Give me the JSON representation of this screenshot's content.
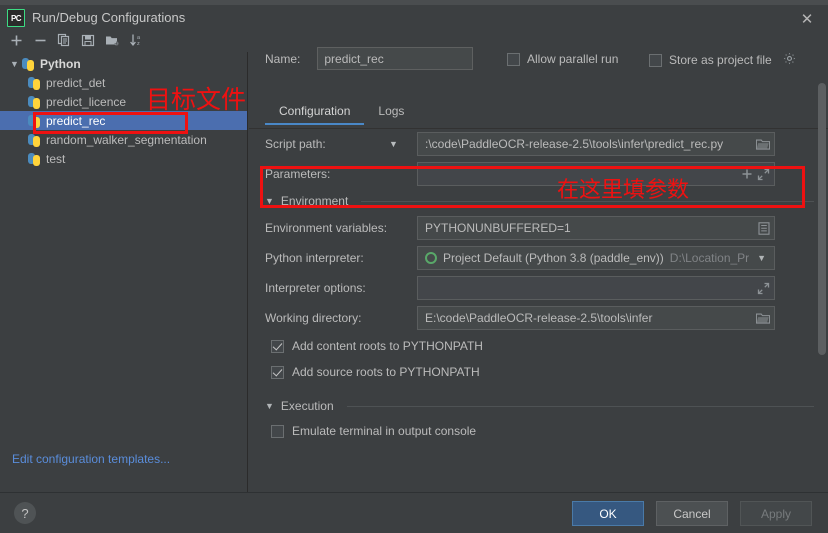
{
  "window": {
    "title": "Run/Debug Configurations",
    "app_icon": "pycharm-icon",
    "close_label": "✕"
  },
  "toolbar": {
    "items": [
      {
        "name": "add-configuration-button",
        "icon": "plus-icon",
        "label": "+"
      },
      {
        "name": "remove-configuration-button",
        "icon": "minus-icon",
        "label": "−"
      },
      {
        "name": "copy-configuration-button",
        "icon": "copy-icon",
        "label": "copy"
      },
      {
        "name": "save-configuration-button",
        "icon": "save-icon",
        "label": "save"
      },
      {
        "name": "new-folder-button",
        "icon": "folder-add-icon",
        "label": "folder"
      },
      {
        "name": "sort-configurations-button",
        "icon": "sort-az-icon",
        "label": "sort"
      }
    ]
  },
  "sidebar": {
    "tree": [
      {
        "label": "Python",
        "level": 0,
        "expanded": true,
        "selected": false
      },
      {
        "label": "predict_det",
        "level": 1,
        "selected": false
      },
      {
        "label": "predict_licence",
        "level": 1,
        "selected": false
      },
      {
        "label": "predict_rec",
        "level": 1,
        "selected": true
      },
      {
        "label": "random_walker_segmentation",
        "level": 1,
        "selected": false
      },
      {
        "label": "test",
        "level": 1,
        "selected": false
      }
    ],
    "edit_templates_link": "Edit configuration templates..."
  },
  "main": {
    "name_label": "Name:",
    "name_value": "predict_rec",
    "allow_parallel_run": {
      "label": "Allow parallel run",
      "checked": false
    },
    "store_as_project_file": {
      "label": "Store as project file",
      "checked": false,
      "gear_icon": "gear-icon"
    },
    "tabs": [
      {
        "label": "Configuration",
        "active": true
      },
      {
        "label": "Logs",
        "active": false
      }
    ],
    "fields": {
      "script_path_label": "Script path:",
      "script_path_value": ":\\code\\PaddleOCR-release-2.5\\tools\\infer\\predict_rec.py",
      "parameters_label": "Parameters:",
      "parameters_value": "",
      "environment_section": "Environment",
      "env_vars_label": "Environment variables:",
      "env_vars_value": "PYTHONUNBUFFERED=1",
      "interpreter_label": "Python interpreter:",
      "interpreter_value": "Project Default (Python 3.8 (paddle_env))",
      "interpreter_path_hint": "D:\\Location_Pr",
      "interpreter_options_label": "Interpreter options:",
      "interpreter_options_value": "",
      "working_dir_label": "Working directory:",
      "working_dir_value": "E:\\code\\PaddleOCR-release-2.5\\tools\\infer",
      "add_content_roots": {
        "label": "Add content roots to PYTHONPATH",
        "checked": true
      },
      "add_source_roots": {
        "label": "Add source roots to PYTHONPATH",
        "checked": true
      },
      "execution_section": "Execution",
      "emulate_terminal": {
        "label": "Emulate terminal in output console",
        "checked": false
      }
    }
  },
  "footer": {
    "help_label": "?",
    "ok_label": "OK",
    "cancel_label": "Cancel",
    "apply_label": "Apply"
  },
  "annotations": [
    {
      "name": "annotation-target-file",
      "text": "目标文件"
    },
    {
      "name": "annotation-fill-parameters-here",
      "text": "在这里填参数"
    }
  ],
  "colors": {
    "accent_blue": "#4b6eaf",
    "annotation_red": "#ee1111",
    "tab_underline": "#4a88c7",
    "link_blue": "#5a8ddb",
    "primary_button": "#365880"
  }
}
